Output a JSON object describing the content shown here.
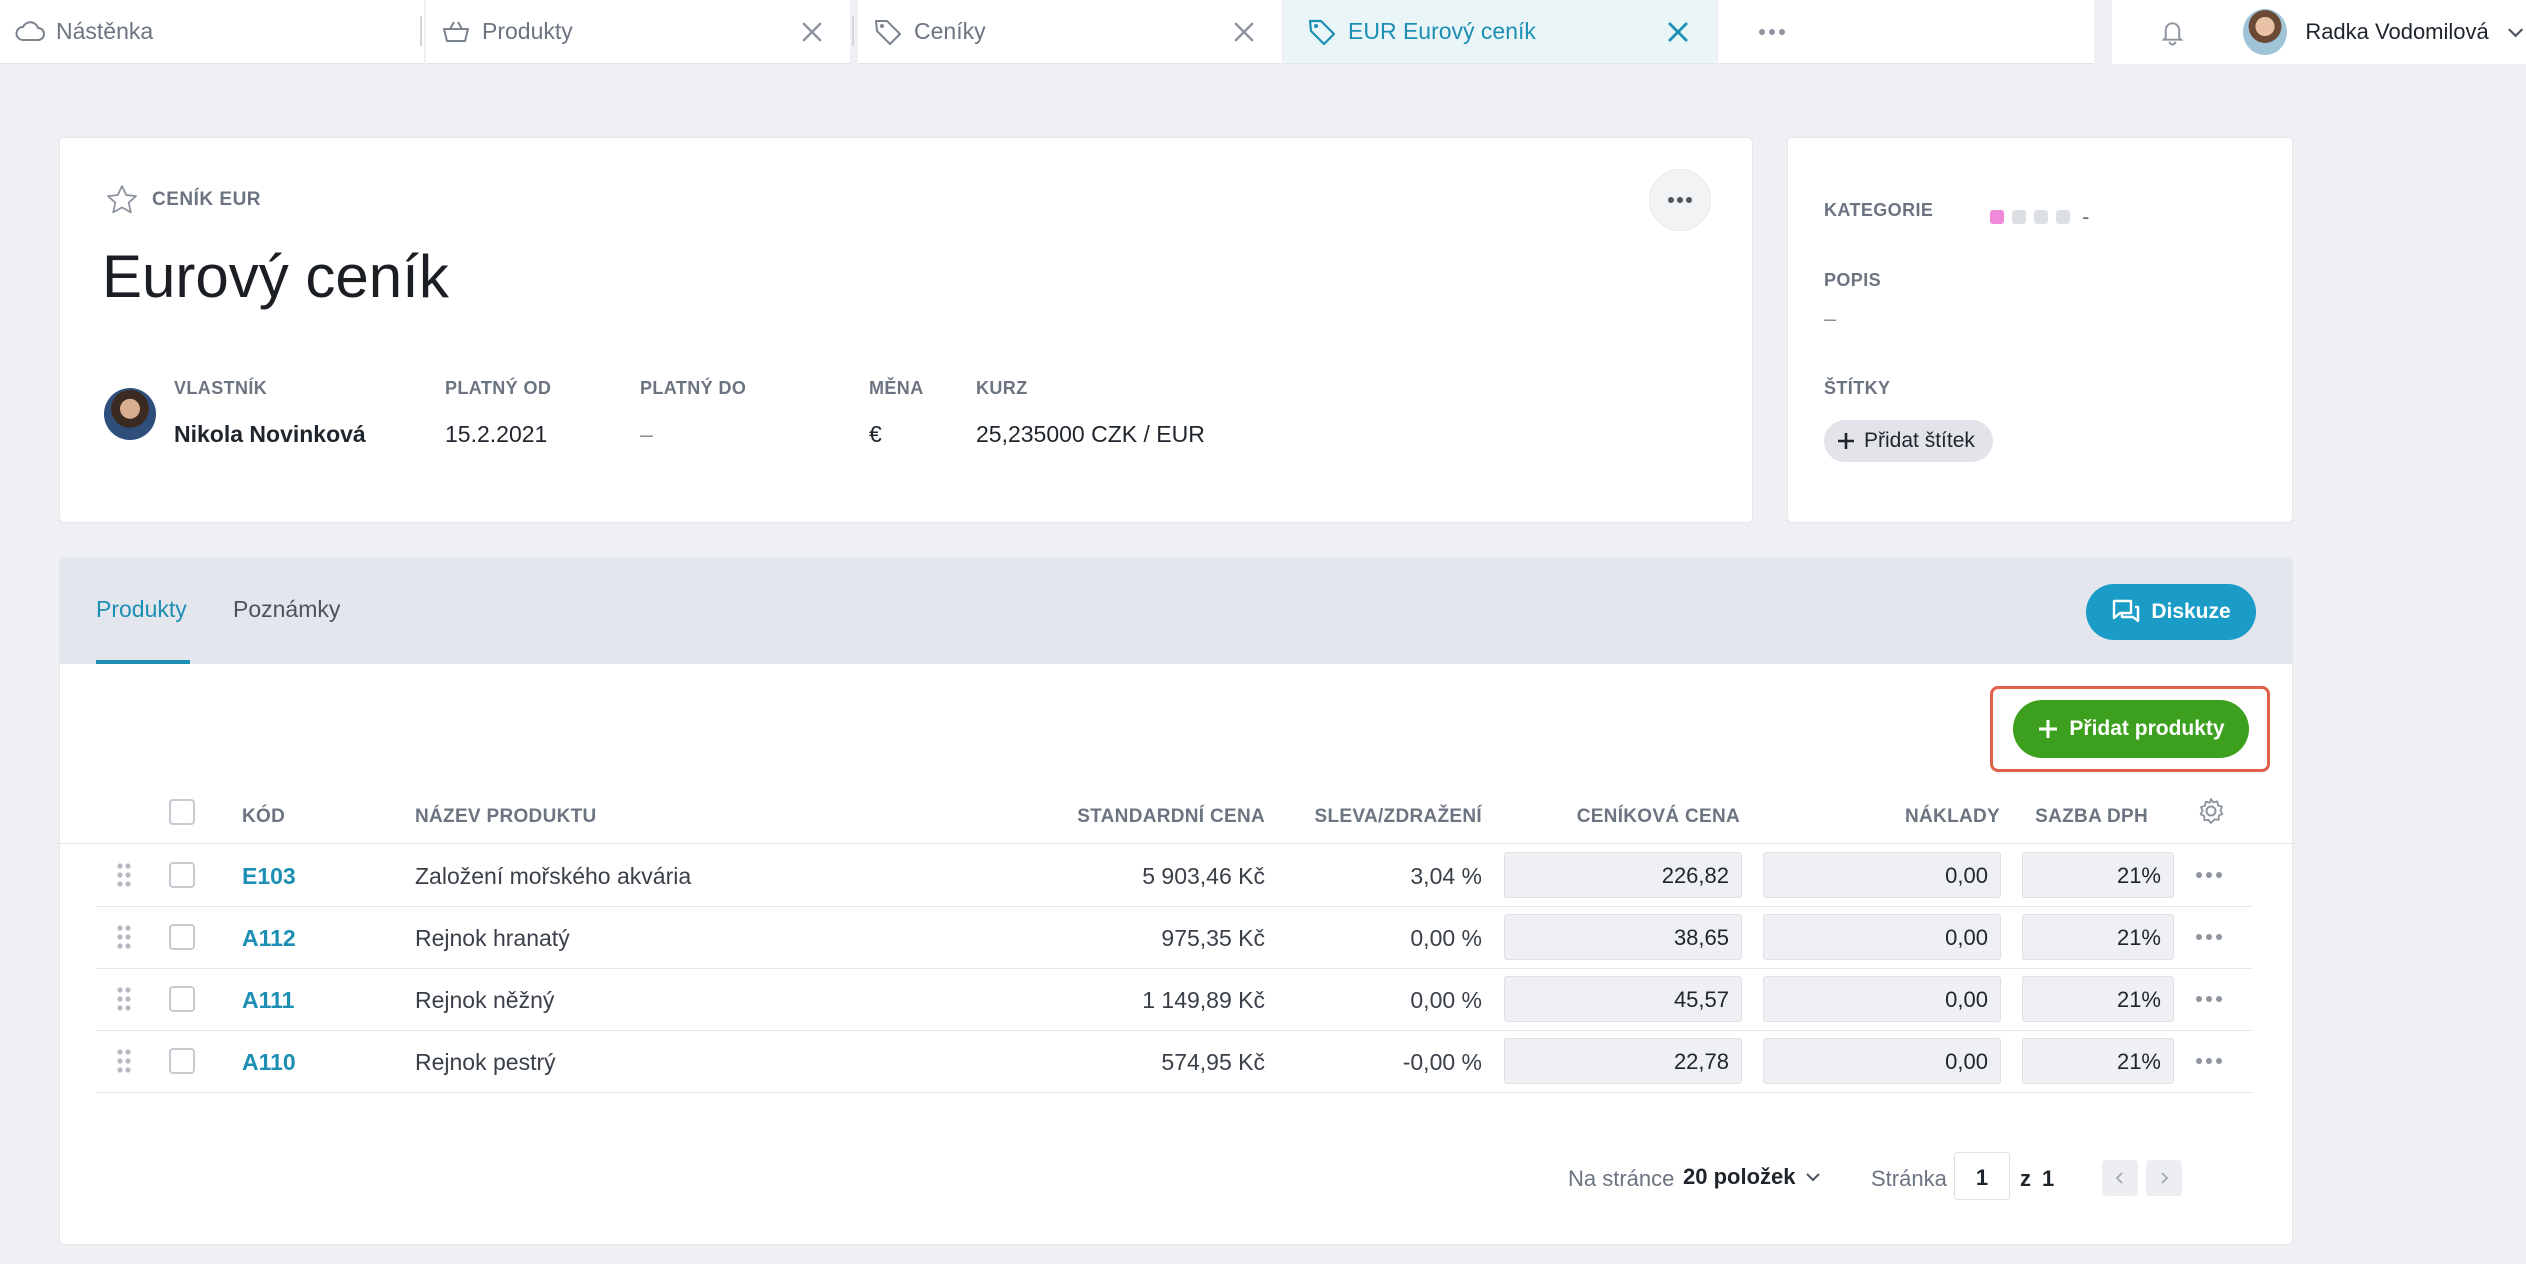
{
  "tabs": [
    {
      "label": "Nástěnka",
      "icon": "cloud-icon",
      "closable": false
    },
    {
      "label": "Produkty",
      "icon": "basket-icon",
      "closable": true
    },
    {
      "label": "Ceníky",
      "icon": "tag-icon",
      "closable": true
    },
    {
      "label": "EUR Eurový ceník",
      "icon": "tag-icon",
      "closable": true,
      "active": true
    }
  ],
  "user": {
    "name": "Radka Vodomilová"
  },
  "record": {
    "type_label": "CENÍK EUR",
    "title": "Eurový ceník",
    "owner_label": "VLASTNÍK",
    "owner_name": "Nikola Novinková",
    "valid_from_label": "PLATNÝ OD",
    "valid_from": "15.2.2021",
    "valid_to_label": "PLATNÝ DO",
    "valid_to": "–",
    "currency_label": "MĚNA",
    "currency": "€",
    "rate_label": "KURZ",
    "rate": "25,235000 CZK / EUR"
  },
  "side": {
    "category_label": "KATEGORIE",
    "category_value": "-",
    "description_label": "POPIS",
    "description_value": "–",
    "tags_label": "ŠTÍTKY",
    "add_tag_label": "Přidat štítek",
    "category_colors": [
      "#f08ad8",
      "#dcdfe4",
      "#dcdfe4",
      "#dcdfe4"
    ]
  },
  "panel": {
    "tab_products": "Produkty",
    "tab_notes": "Poznámky",
    "discussion_label": "Diskuze",
    "add_products_label": "Přidat produkty"
  },
  "table": {
    "headers": {
      "code": "KÓD",
      "name": "NÁZEV PRODUKTU",
      "std_price": "STANDARDNÍ CENA",
      "discount": "SLEVA/ZDRAŽENÍ",
      "list_price": "CENÍKOVÁ CENA",
      "costs": "NÁKLADY",
      "vat": "SAZBA DPH"
    },
    "rows": [
      {
        "code": "E103",
        "name": "Založení mořského akvária",
        "std_price": "5 903,46 Kč",
        "discount": "3,04 %",
        "list_price": "226,82",
        "costs": "0,00",
        "vat": "21%"
      },
      {
        "code": "A112",
        "name": "Rejnok hranatý",
        "std_price": "975,35 Kč",
        "discount": "0,00 %",
        "list_price": "38,65",
        "costs": "0,00",
        "vat": "21%"
      },
      {
        "code": "A111",
        "name": "Rejnok něžný",
        "std_price": "1 149,89 Kč",
        "discount": "0,00 %",
        "list_price": "45,57",
        "costs": "0,00",
        "vat": "21%"
      },
      {
        "code": "A110",
        "name": "Rejnok pestrý",
        "std_price": "574,95 Kč",
        "discount": "-0,00 %",
        "list_price": "22,78",
        "costs": "0,00",
        "vat": "21%"
      }
    ]
  },
  "pagination": {
    "per_page_label": "Na stránce",
    "per_page_value": "20 položek",
    "page_label": "Stránka",
    "page_value": "1",
    "of_label": "z",
    "total_pages": "1"
  },
  "colors": {
    "accent": "#1d8fb4",
    "discussion_button": "#1b9cc6",
    "add_button": "#3ca01e",
    "highlight": "#e0604a"
  }
}
